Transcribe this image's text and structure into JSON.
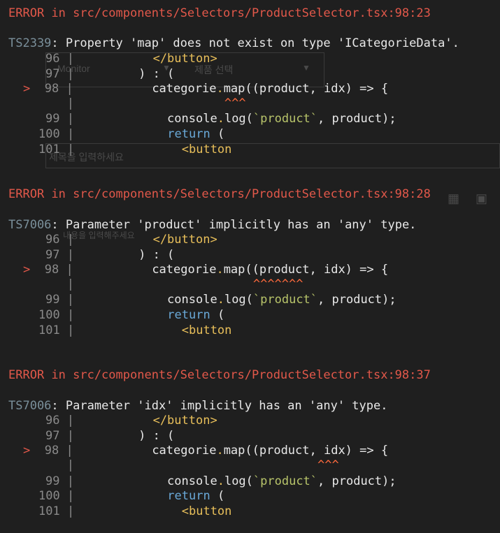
{
  "background_ui": {
    "select_left": "Monitor",
    "select_right": "제품 선택",
    "title_placeholder": "제목을 입력하세요",
    "content_placeholder": "내용을 입력해주세요"
  },
  "errors": [
    {
      "header": "ERROR in src/components/Selectors/ProductSelector.tsx:98:23",
      "code": "TS2339",
      "message": "Property 'map' does not exist on type 'ICategorieData'.",
      "marker": "^^^"
    },
    {
      "header": "ERROR in src/components/Selectors/ProductSelector.tsx:98:28",
      "code": "TS7006",
      "message": "Parameter 'product' implicitly has an 'any' type.",
      "marker": "^^^^^^^"
    },
    {
      "header": "ERROR in src/components/Selectors/ProductSelector.tsx:98:37",
      "code": "TS7006",
      "message": "Parameter 'idx' implicitly has an 'any' type.",
      "marker": "^^^"
    }
  ],
  "snippet": {
    "l96": "96",
    "l97": "97",
    "l98": "98",
    "l99": "99",
    "l100": "100",
    "l101": "101",
    "pointer": ">",
    "pipe": "|",
    "code96": "</button>",
    "code97": ") : (",
    "code98_var": "categorie",
    "code98_fn": "map((product, idx) => {",
    "code99_a": "console",
    "code99_b": "log(",
    "code99_str": "`product`",
    "code99_c": ", product);",
    "code100": "return",
    "code100_b": " (",
    "code101": "<button"
  },
  "colors": {
    "background": "#1f1f1f",
    "error": "#e2584a",
    "keyword": "#6aa9d8",
    "string": "#b8c46a",
    "caret": "#ff6a3d"
  }
}
